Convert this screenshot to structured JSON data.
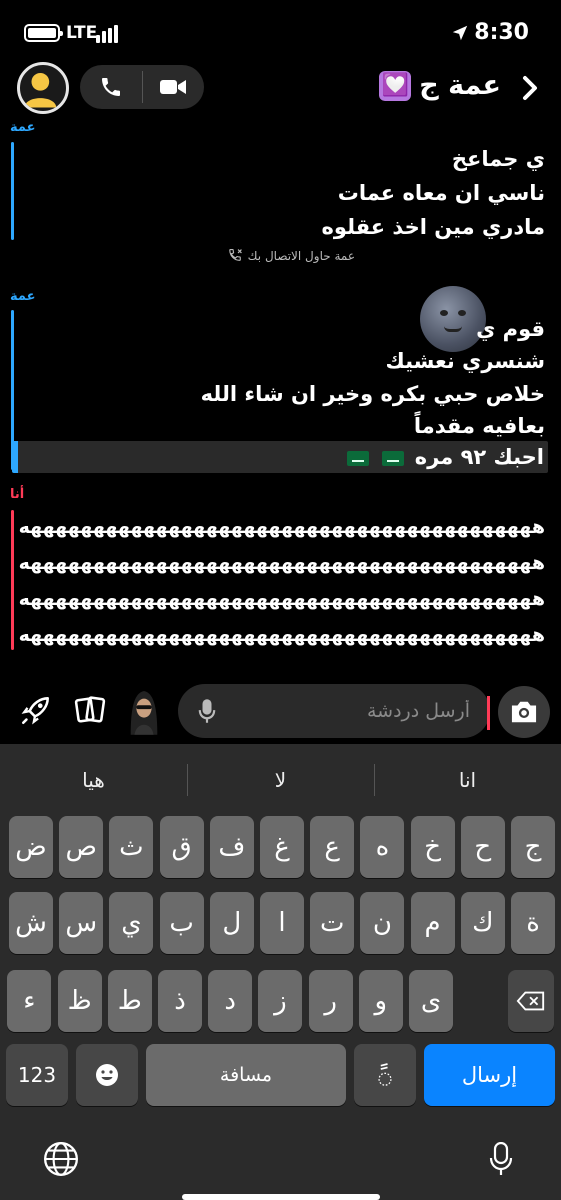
{
  "status": {
    "network": "LTE",
    "time": "8:30"
  },
  "header": {
    "contact_name": "عمة ج",
    "heart_emoji": "💟"
  },
  "messages": [
    {
      "sender": "عمة",
      "sender_color": "#2ea8ff",
      "lines": [
        "ي جماعخ",
        "ناسي ان معاه عمات",
        "مادري مين اخذ عقلوه"
      ]
    },
    {
      "notice": "عمة حاول الاتصال بك"
    },
    {
      "sender": "عمة",
      "sender_color": "#2ea8ff",
      "lines": [
        "قوم ي",
        "شنسري نعشيك",
        "خلاص حبي بكره وخير ان شاء الله",
        "بعافيه مقدماً"
      ],
      "quote": "احبك ٩٢ مره"
    },
    {
      "sender": "أنا",
      "sender_color": "#ff3b57",
      "lines": [
        "هههههههههههههههههههههههههههههههههههههههههه",
        "هههههههههههههههههههههههههههههههههههههههههه",
        "هههههههههههههههههههههههههههههههههههههههههه",
        "هههههههههههههههههههههههههههههههههههههههههه"
      ]
    }
  ],
  "input": {
    "placeholder": "أرسل دردشة"
  },
  "keyboard": {
    "suggestions": [
      "انا",
      "لا",
      "هيا"
    ],
    "row1": [
      "ج",
      "ح",
      "خ",
      "ه",
      "ع",
      "غ",
      "ف",
      "ق",
      "ث",
      "ص",
      "ض"
    ],
    "row2": [
      "ة",
      "ك",
      "م",
      "ن",
      "ت",
      "ا",
      "ل",
      "ب",
      "ي",
      "س",
      "ش"
    ],
    "row3": [
      "ى",
      "و",
      "ر",
      "ز",
      "د",
      "ذ",
      "ط",
      "ظ",
      "ء"
    ],
    "numbers_label": "123",
    "space_label": "مسافة",
    "send_label": "إرسال"
  }
}
